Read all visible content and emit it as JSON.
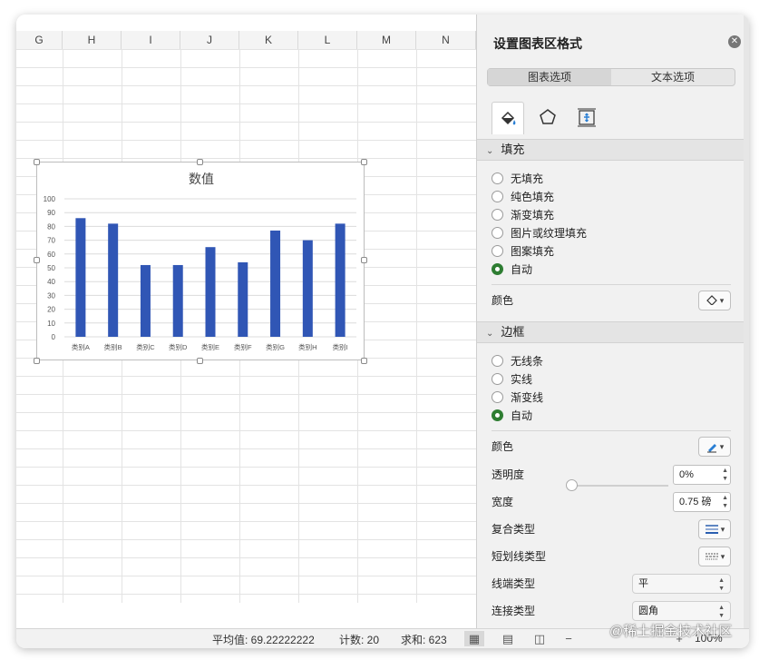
{
  "sheet": {
    "columns": [
      "G",
      "H",
      "I",
      "J",
      "K",
      "L",
      "M",
      "N"
    ]
  },
  "chart_data": {
    "type": "bar",
    "title": "数值",
    "categories": [
      "类别A",
      "类别B",
      "类别C",
      "类别D",
      "类别E",
      "类别F",
      "类别G",
      "类别H",
      "类别I"
    ],
    "values": [
      86,
      82,
      52,
      52,
      65,
      54,
      77,
      70,
      82
    ],
    "ylim": [
      0,
      100
    ],
    "yticks": [
      "0",
      "10",
      "20",
      "30",
      "40",
      "50",
      "60",
      "70",
      "80",
      "90",
      "100"
    ],
    "grid": true,
    "bar_color": "#3056b5"
  },
  "panel": {
    "title": "设置图表区格式",
    "close_icon": "close-icon",
    "tabs": [
      "图表选项",
      "文本选项"
    ],
    "icon_tabs": [
      "fill-bucket-icon",
      "pentagon-icon",
      "size-properties-icon"
    ],
    "fill": {
      "header": "填充",
      "options": [
        "无填充",
        "纯色填充",
        "渐变填充",
        "图片或纹理填充",
        "图案填充",
        "自动"
      ],
      "selected": "自动",
      "color_label": "颜色"
    },
    "border": {
      "header": "边框",
      "options": [
        "无线条",
        "实线",
        "渐变线",
        "自动"
      ],
      "selected": "自动",
      "color_label": "颜色",
      "transparency_label": "透明度",
      "transparency_value": "0%",
      "width_label": "宽度",
      "width_value": "0.75 磅",
      "compound_label": "复合类型",
      "dash_label": "短划线类型",
      "cap_label": "线端类型",
      "cap_value": "平",
      "join_label": "连接类型",
      "join_value": "圆角"
    },
    "accent": "#2e7d32"
  },
  "status": {
    "average": "平均值: 69.22222222",
    "count": "计数: 20",
    "sum": "求和: 623",
    "zoom": "100%"
  },
  "watermark": "@稀土掘金技术社区"
}
